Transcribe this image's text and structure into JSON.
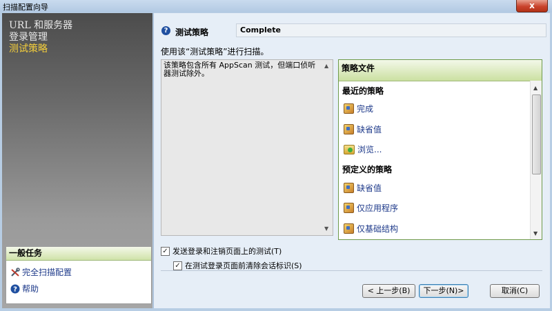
{
  "window": {
    "title": "扫描配置向导",
    "close_label": "x"
  },
  "nav": {
    "items": [
      {
        "label": "URL 和服务器",
        "active": false
      },
      {
        "label": "登录管理",
        "active": false
      },
      {
        "label": "测试策略",
        "active": true
      }
    ]
  },
  "tasks": {
    "header": "一般任务",
    "items": [
      {
        "label": "完全扫描配置",
        "icon": "tools-icon"
      },
      {
        "label": "帮助",
        "icon": "help-icon"
      }
    ]
  },
  "policy": {
    "label": "测试策略",
    "value": "Complete",
    "instruction": "使用该“测试策略”进行扫描。",
    "description": "该策略包含所有 AppScan 测试，但端口侦听器测试除外。"
  },
  "policy_files": {
    "header": "策略文件",
    "recent_title": "最近的策略",
    "recent": [
      "完成",
      "缺省值"
    ],
    "browse": "浏览...",
    "predefined_title": "预定义的策略",
    "predefined": [
      "缺省值",
      "仅应用程序",
      "仅基础结构"
    ]
  },
  "options": {
    "send_login_logout": {
      "label": "发送登录和注销页面上的测试(T)",
      "checked": true
    },
    "clear_session_ids": {
      "label": "在测试登录页面前清除会话标识(S)",
      "checked": true
    }
  },
  "buttons": {
    "back": "< 上一步(B)",
    "next": "下一步(N)>",
    "cancel": "取消(C)"
  }
}
